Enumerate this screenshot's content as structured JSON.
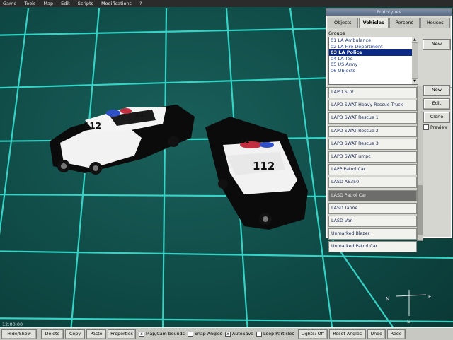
{
  "menu": [
    "Game",
    "Tools",
    "Map",
    "Edit",
    "Scripts",
    "Modifications",
    "?"
  ],
  "panel": {
    "title": "Prototypes",
    "tabs": [
      {
        "label": "Objects",
        "active": false
      },
      {
        "label": "Vehicles",
        "active": true
      },
      {
        "label": "Persons",
        "active": false
      },
      {
        "label": "Houses",
        "active": false
      }
    ],
    "groups_label": "Groups",
    "groups": [
      {
        "label": "01 LA Ambulance",
        "selected": false
      },
      {
        "label": "02 LA Fire Department",
        "selected": false
      },
      {
        "label": "03 LA Police",
        "selected": true
      },
      {
        "label": "04 LA Tec",
        "selected": false
      },
      {
        "label": "05 US Army",
        "selected": false
      },
      {
        "label": "06 Objects",
        "selected": false
      }
    ],
    "group_new_label": "New",
    "prototypes": [
      {
        "label": "LAPD SUV",
        "selected": false
      },
      {
        "label": "LAPD SWAT Heavy Rescue Truck",
        "selected": false
      },
      {
        "label": "LAPD SWAT Rescue 1",
        "selected": false
      },
      {
        "label": "LAPD SWAT Rescue 2",
        "selected": false
      },
      {
        "label": "LAPD SWAT Rescue 3",
        "selected": false
      },
      {
        "label": "LAPD SWAT umpc",
        "selected": false
      },
      {
        "label": "LAPP Patrol Car",
        "selected": false
      },
      {
        "label": "LASD AS350",
        "selected": false
      },
      {
        "label": "LASD Patrol Car",
        "selected": true
      },
      {
        "label": "LASD Tahoe",
        "selected": false
      },
      {
        "label": "LASD Van",
        "selected": false
      },
      {
        "label": "Unmarked Blazer",
        "selected": false
      },
      {
        "label": "Unmarked Patrol Car",
        "selected": false
      }
    ],
    "proto_new_label": "New",
    "edit_label": "Edit",
    "clone_label": "Clone",
    "preview_label": "Preview"
  },
  "viewport": {
    "car1_number": "112",
    "car1_roof": "11",
    "car2_number": "112",
    "car2_roof": "11"
  },
  "compass": {
    "n": "N",
    "e": "E",
    "s": "S"
  },
  "clock": "12:00:00",
  "toolbar": {
    "hide_show": "Hide/Show",
    "delete": "Delete",
    "copy": "Copy",
    "paste": "Paste",
    "properties": "Properties",
    "map_cam_bounds": "Map/Cam bounds",
    "snap_angles": "Snap Angles",
    "autosave": "AutoSave",
    "loop_particles": "Loop Particles",
    "lights_off": "Lights: Off",
    "reset_angles": "Reset Angles",
    "undo": "Undo",
    "redo": "Redo"
  },
  "colors": {
    "grid_line": "#39e2d3",
    "ground": "#0f4a46",
    "selection": "#0a2a86"
  }
}
